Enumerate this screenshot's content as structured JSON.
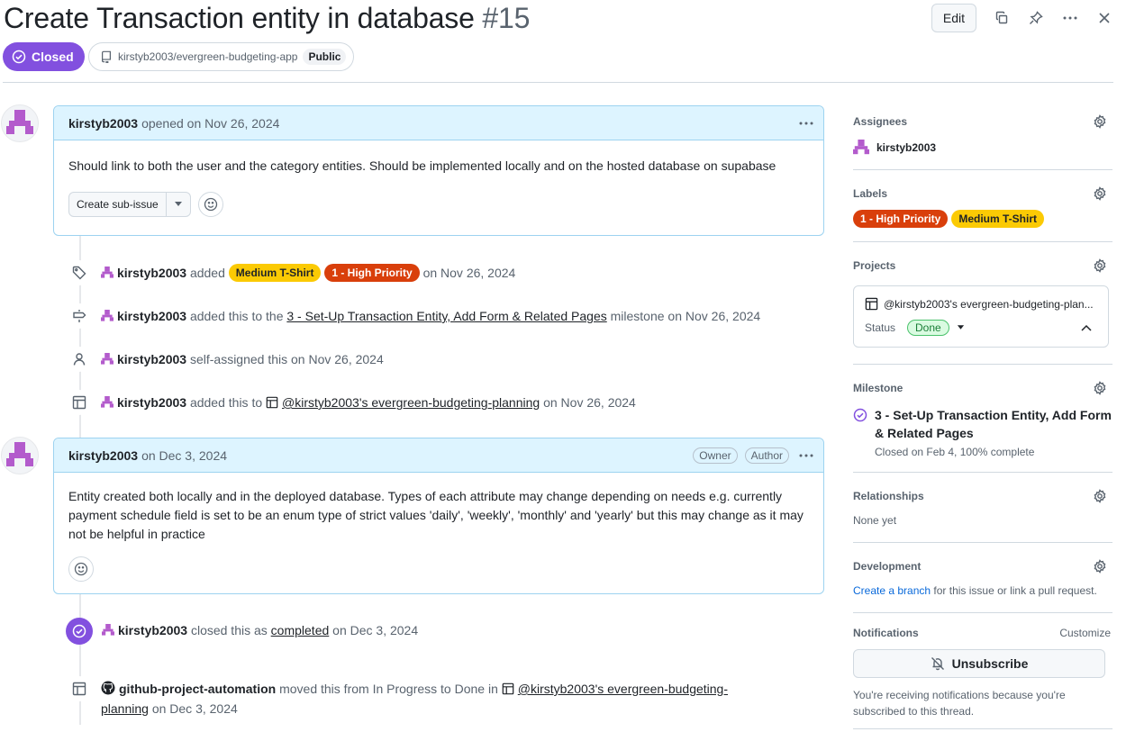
{
  "issue": {
    "title": "Create Transaction entity in database",
    "number": "#15",
    "state": "Closed",
    "repo": "kirstyb2003/evergreen-budgeting-app",
    "visibility": "Public"
  },
  "toolbar": {
    "edit_label": "Edit"
  },
  "comments": [
    {
      "author": "kirstyb2003",
      "meta": "opened on Nov 26, 2024",
      "body": "Should link to both the user and the category entities. Should be implemented locally and on the hosted database on supabase",
      "sub_issue_label": "Create sub-issue"
    },
    {
      "author": "kirstyb2003",
      "meta": "on Dec 3, 2024",
      "owner_tag": "Owner",
      "author_tag": "Author",
      "body": "Entity created both locally and in the deployed database. Types of each attribute may change depending on needs e.g. currently payment schedule field is set to be an enum type of strict values 'daily', 'weekly', 'monthly' and 'yearly' but this may change as it may not be helpful in practice"
    }
  ],
  "events": {
    "labels": {
      "user": "kirstyb2003",
      "verb": "added",
      "label_medium": "Medium T-Shirt",
      "label_high": "1 - High Priority",
      "date": "on Nov 26, 2024"
    },
    "milestone": {
      "user": "kirstyb2003",
      "verb": "added this to the",
      "milestone": "3 - Set-Up Transaction Entity, Add Form & Related Pages",
      "suffix": "milestone on Nov 26, 2024"
    },
    "assign": {
      "user": "kirstyb2003",
      "text": "self-assigned this on Nov 26, 2024"
    },
    "project": {
      "user": "kirstyb2003",
      "verb": "added this to",
      "project": "@kirstyb2003's evergreen-budgeting-planning",
      "date": "on Nov 26, 2024"
    },
    "closed": {
      "user": "kirstyb2003",
      "verb": "closed this as",
      "reason": "completed",
      "date": "on Dec 3, 2024"
    },
    "moved": {
      "user": "github-project-automation",
      "verb": "moved this from In Progress to Done in",
      "project_line1": "@kirstyb2003's evergreen-budgeting-",
      "project_line2": "planning",
      "date": "on Dec 3, 2024"
    }
  },
  "sidebar": {
    "assignees": {
      "heading": "Assignees",
      "user": "kirstyb2003"
    },
    "labels": {
      "heading": "Labels",
      "items": [
        "1 - High Priority",
        "Medium T-Shirt"
      ]
    },
    "projects": {
      "heading": "Projects",
      "project_name": "@kirstyb2003's evergreen-budgeting-plan...",
      "status_label": "Status",
      "status_value": "Done"
    },
    "milestone": {
      "heading": "Milestone",
      "title_line1": "3 - Set-Up Transaction Entity, Add Form",
      "title_line2": "& Related Pages",
      "progress": "Closed on Feb 4, 100% complete"
    },
    "relationships": {
      "heading": "Relationships",
      "value": "None yet"
    },
    "development": {
      "heading": "Development",
      "link": "Create a branch",
      "text": "for this issue or link a pull request."
    },
    "notifications": {
      "heading": "Notifications",
      "customize": "Customize",
      "button": "Unsubscribe",
      "note_line1": "You're receiving notifications because you're",
      "note_line2": "subscribed to this thread."
    }
  },
  "colors": {
    "closed_purple": "#8250df",
    "label_high": "#d93f0b",
    "label_medium": "#fbca04",
    "comment_header": "#ddf4ff",
    "link_blue": "#0969da"
  },
  "icons": [
    "copy-icon",
    "pin-icon",
    "kebab-icon",
    "close-icon",
    "tag-icon",
    "milestone-icon",
    "person-icon",
    "table-icon",
    "check-circle-icon",
    "gear-icon",
    "bell-slash-icon",
    "smiley-icon",
    "repo-icon",
    "github-icon"
  ]
}
